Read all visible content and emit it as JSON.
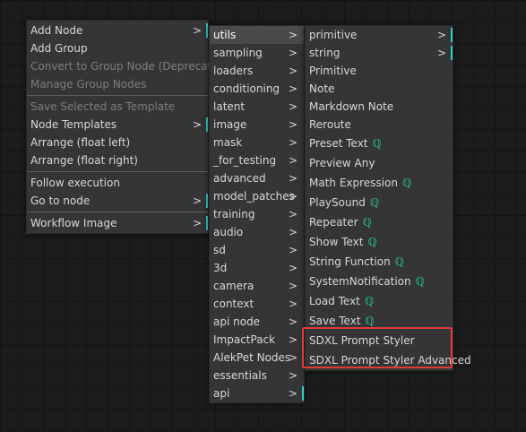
{
  "main_menu": [
    {
      "label": "Add Node",
      "arrow": ">",
      "bar": true,
      "disabled": false
    },
    {
      "label": "Add Group",
      "arrow": "",
      "bar": false,
      "disabled": false
    },
    {
      "label": "Convert to Group Node (Deprecated)",
      "arrow": "",
      "bar": false,
      "disabled": true
    },
    {
      "label": "Manage Group Nodes",
      "arrow": "",
      "bar": false,
      "disabled": true
    },
    {
      "sep": true
    },
    {
      "label": "Save Selected as Template",
      "arrow": "",
      "bar": false,
      "disabled": true
    },
    {
      "label": "Node Templates",
      "arrow": ">",
      "bar": true,
      "disabled": false
    },
    {
      "label": "Arrange (float left)",
      "arrow": "",
      "bar": false,
      "disabled": false
    },
    {
      "label": "Arrange (float right)",
      "arrow": "",
      "bar": false,
      "disabled": false
    },
    {
      "sep": true
    },
    {
      "label": "Follow execution",
      "arrow": "",
      "bar": false,
      "disabled": false
    },
    {
      "label": "Go to node",
      "arrow": ">",
      "bar": true,
      "disabled": false
    },
    {
      "sep": true
    },
    {
      "label": "Workflow Image",
      "arrow": ">",
      "bar": true,
      "disabled": false
    }
  ],
  "category_menu": [
    {
      "label": "utils",
      "arrow": ">",
      "bar": false,
      "active": true
    },
    {
      "label": "sampling",
      "arrow": ">",
      "bar": false
    },
    {
      "label": "loaders",
      "arrow": ">",
      "bar": false
    },
    {
      "label": "conditioning",
      "arrow": ">",
      "bar": false
    },
    {
      "label": "latent",
      "arrow": ">",
      "bar": false
    },
    {
      "label": "image",
      "arrow": ">",
      "bar": false
    },
    {
      "label": "mask",
      "arrow": ">",
      "bar": false
    },
    {
      "label": "_for_testing",
      "arrow": ">",
      "bar": false
    },
    {
      "label": "advanced",
      "arrow": ">",
      "bar": false
    },
    {
      "label": "model_patches",
      "arrow": ">",
      "bar": false
    },
    {
      "label": "training",
      "arrow": ">",
      "bar": false
    },
    {
      "label": "audio",
      "arrow": ">",
      "bar": false
    },
    {
      "label": "sd",
      "arrow": ">",
      "bar": false
    },
    {
      "label": "3d",
      "arrow": ">",
      "bar": false
    },
    {
      "label": "camera",
      "arrow": ">",
      "bar": false
    },
    {
      "label": "context",
      "arrow": ">",
      "bar": false
    },
    {
      "label": "api node",
      "arrow": ">",
      "bar": false
    },
    {
      "label": "ImpactPack",
      "arrow": ">",
      "bar": false
    },
    {
      "label": "AlekPet Nodes",
      "arrow": ">",
      "bar": false
    },
    {
      "label": "essentials",
      "arrow": ">",
      "bar": false
    },
    {
      "label": "api",
      "arrow": ">",
      "bar": true
    }
  ],
  "utils_menu": [
    {
      "label": "primitive",
      "arrow": ">",
      "bar": true,
      "badge": false,
      "short": true
    },
    {
      "label": "string",
      "arrow": ">",
      "bar": true,
      "badge": false,
      "short": true
    },
    {
      "label": "Primitive",
      "arrow": "",
      "bar": false,
      "badge": false,
      "short": true
    },
    {
      "label": "Note",
      "arrow": "",
      "bar": false,
      "badge": false,
      "short": true
    },
    {
      "label": "Markdown Note",
      "arrow": "",
      "bar": false,
      "badge": false,
      "short": true
    },
    {
      "label": "Reroute",
      "arrow": "",
      "bar": false,
      "badge": false,
      "short": true
    },
    {
      "label": "Preset Text",
      "arrow": "",
      "bar": false,
      "badge": true
    },
    {
      "label": "Preview Any",
      "arrow": "",
      "bar": false,
      "badge": false
    },
    {
      "label": "Math Expression",
      "arrow": "",
      "bar": false,
      "badge": true
    },
    {
      "label": "PlaySound",
      "arrow": "",
      "bar": false,
      "badge": true
    },
    {
      "label": "Repeater",
      "arrow": "",
      "bar": false,
      "badge": true
    },
    {
      "label": "Show Text",
      "arrow": "",
      "bar": false,
      "badge": true
    },
    {
      "label": "String Function",
      "arrow": "",
      "bar": false,
      "badge": true
    },
    {
      "label": "SystemNotification",
      "arrow": "",
      "bar": false,
      "badge": true
    },
    {
      "label": "Load Text",
      "arrow": "",
      "bar": false,
      "badge": true
    },
    {
      "label": "Save Text",
      "arrow": "",
      "bar": false,
      "badge": true
    },
    {
      "label": "SDXL Prompt Styler",
      "arrow": "",
      "bar": false,
      "badge": false
    },
    {
      "label": "SDXL Prompt Styler Advanced",
      "arrow": "",
      "bar": false,
      "badge": false
    }
  ],
  "badge_icon": "ℚ",
  "colors": {
    "accent": "#2fd1c9",
    "badge": "#27b47a",
    "highlight": "#e03a3a"
  }
}
